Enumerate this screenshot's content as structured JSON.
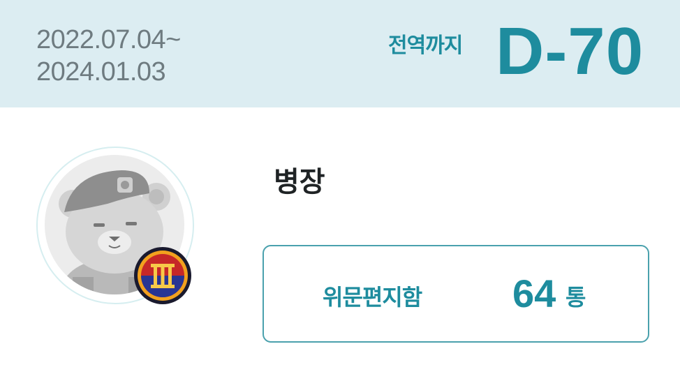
{
  "header": {
    "period_start": "2022.07.04~",
    "period_end": "2024.01.03",
    "dday_label": "전역까지",
    "dday_value": "D-70",
    "background_color": "#dcedf2",
    "accent_color": "#1e8c9e"
  },
  "profile": {
    "avatar_icon": "bear-soldier-avatar",
    "rank_badge_icon": "sergeant-rank-insignia",
    "rank_title": "병장"
  },
  "mailbox": {
    "label": "위문편지함",
    "count": "64",
    "unit": "통"
  }
}
